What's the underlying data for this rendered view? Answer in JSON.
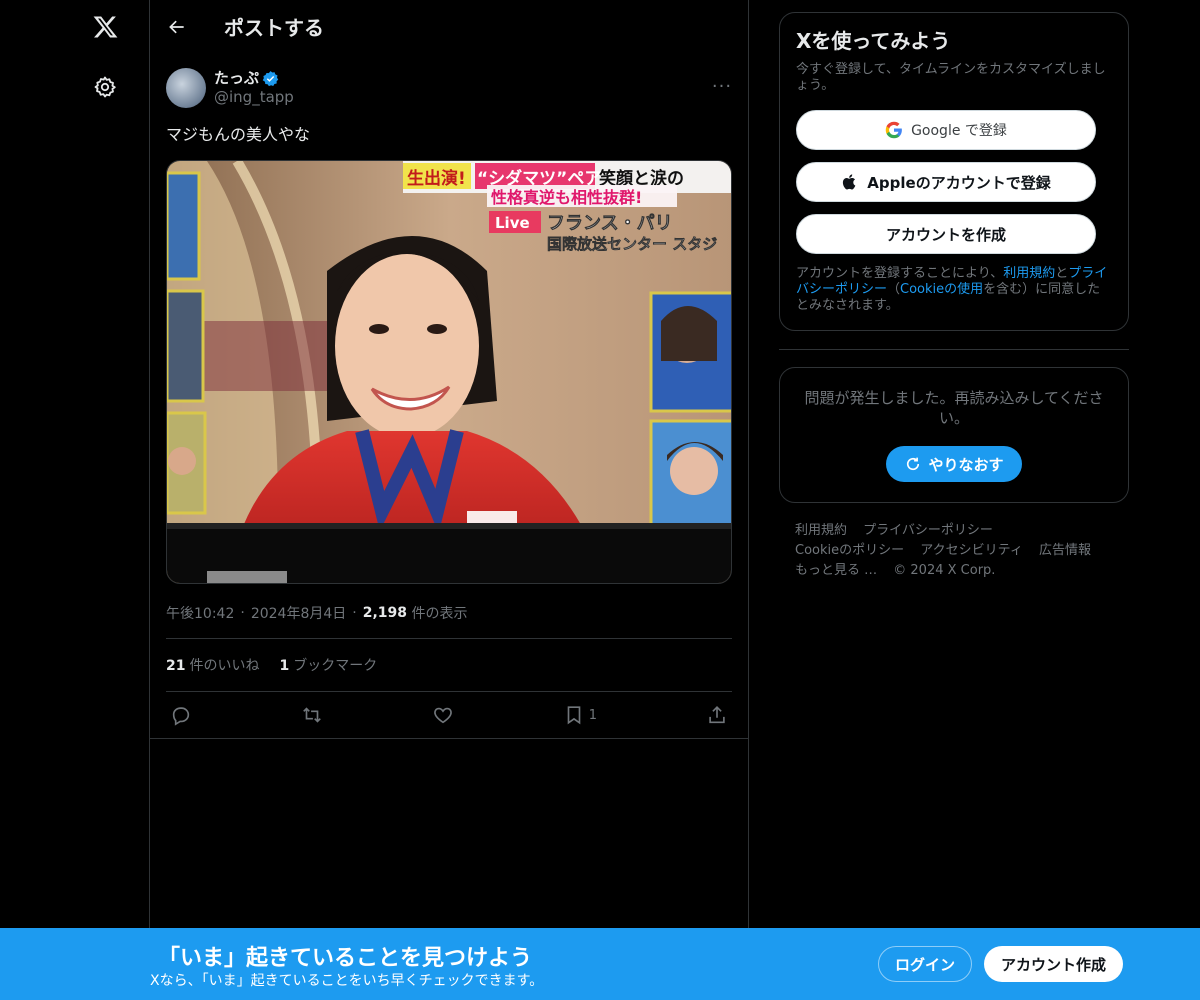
{
  "nav": {
    "logo_icon": "x-logo-icon",
    "settings_icon": "gear-icon"
  },
  "header": {
    "back_icon": "back-arrow-icon",
    "title": "ポストする"
  },
  "post": {
    "display_name": "たっぷ",
    "handle": "@ing_tapp",
    "verified": true,
    "text": "マジもんの美人やな",
    "time": "午後10:42",
    "date": "2024年8月4日",
    "views_count": "2,198",
    "views_label": "件の表示",
    "likes_count": "21",
    "likes_label": "件のいいね",
    "bookmarks_count": "1",
    "bookmarks_label": "ブックマーク",
    "bookmark_action_count": "1"
  },
  "media": {
    "caption_1a": "生出演!",
    "caption_1b": "“シダマツ”ペア",
    "caption_1c": "笑顔と涙の",
    "caption_2": "性格真逆も相性抜群!",
    "caption_live": "Live",
    "caption_3": "フランス・パリ",
    "caption_4": "国際放送センター スタジ"
  },
  "signup_card": {
    "title": "Xを使ってみよう",
    "subtitle": "今すぐ登録して、タイムラインをカスタマイズしましょう。",
    "google_label": "Google で登録",
    "apple_label": "Appleのアカウントで登録",
    "create_label": "アカウントを作成",
    "terms_prefix": "アカウントを登録することにより、",
    "terms_link1": "利用規約",
    "terms_and": "と",
    "terms_link2": "プライバシーポリシー",
    "terms_mid": "（",
    "terms_link3": "Cookieの使用",
    "terms_suffix": "を含む）に同意したとみなされます。"
  },
  "error_card": {
    "message": "問題が発生しました。再読み込みしてください。",
    "retry_label": "やりなおす"
  },
  "footer": {
    "links": [
      "利用規約",
      "プライバシーポリシー",
      "Cookieのポリシー",
      "アクセシビリティ",
      "広告情報",
      "もっと見る …"
    ],
    "copyright": "© 2024 X Corp."
  },
  "bottom_bar": {
    "title": "「いま」起きていることを見つけよう",
    "subtitle": "Xなら、「いま」起きていることをいち早くチェックできます。",
    "login_label": "ログイン",
    "signup_label": "アカウント作成"
  },
  "colors": {
    "accent": "#1d9bf0",
    "background": "#000000",
    "border": "#2f3336",
    "muted_text": "#71767b"
  }
}
